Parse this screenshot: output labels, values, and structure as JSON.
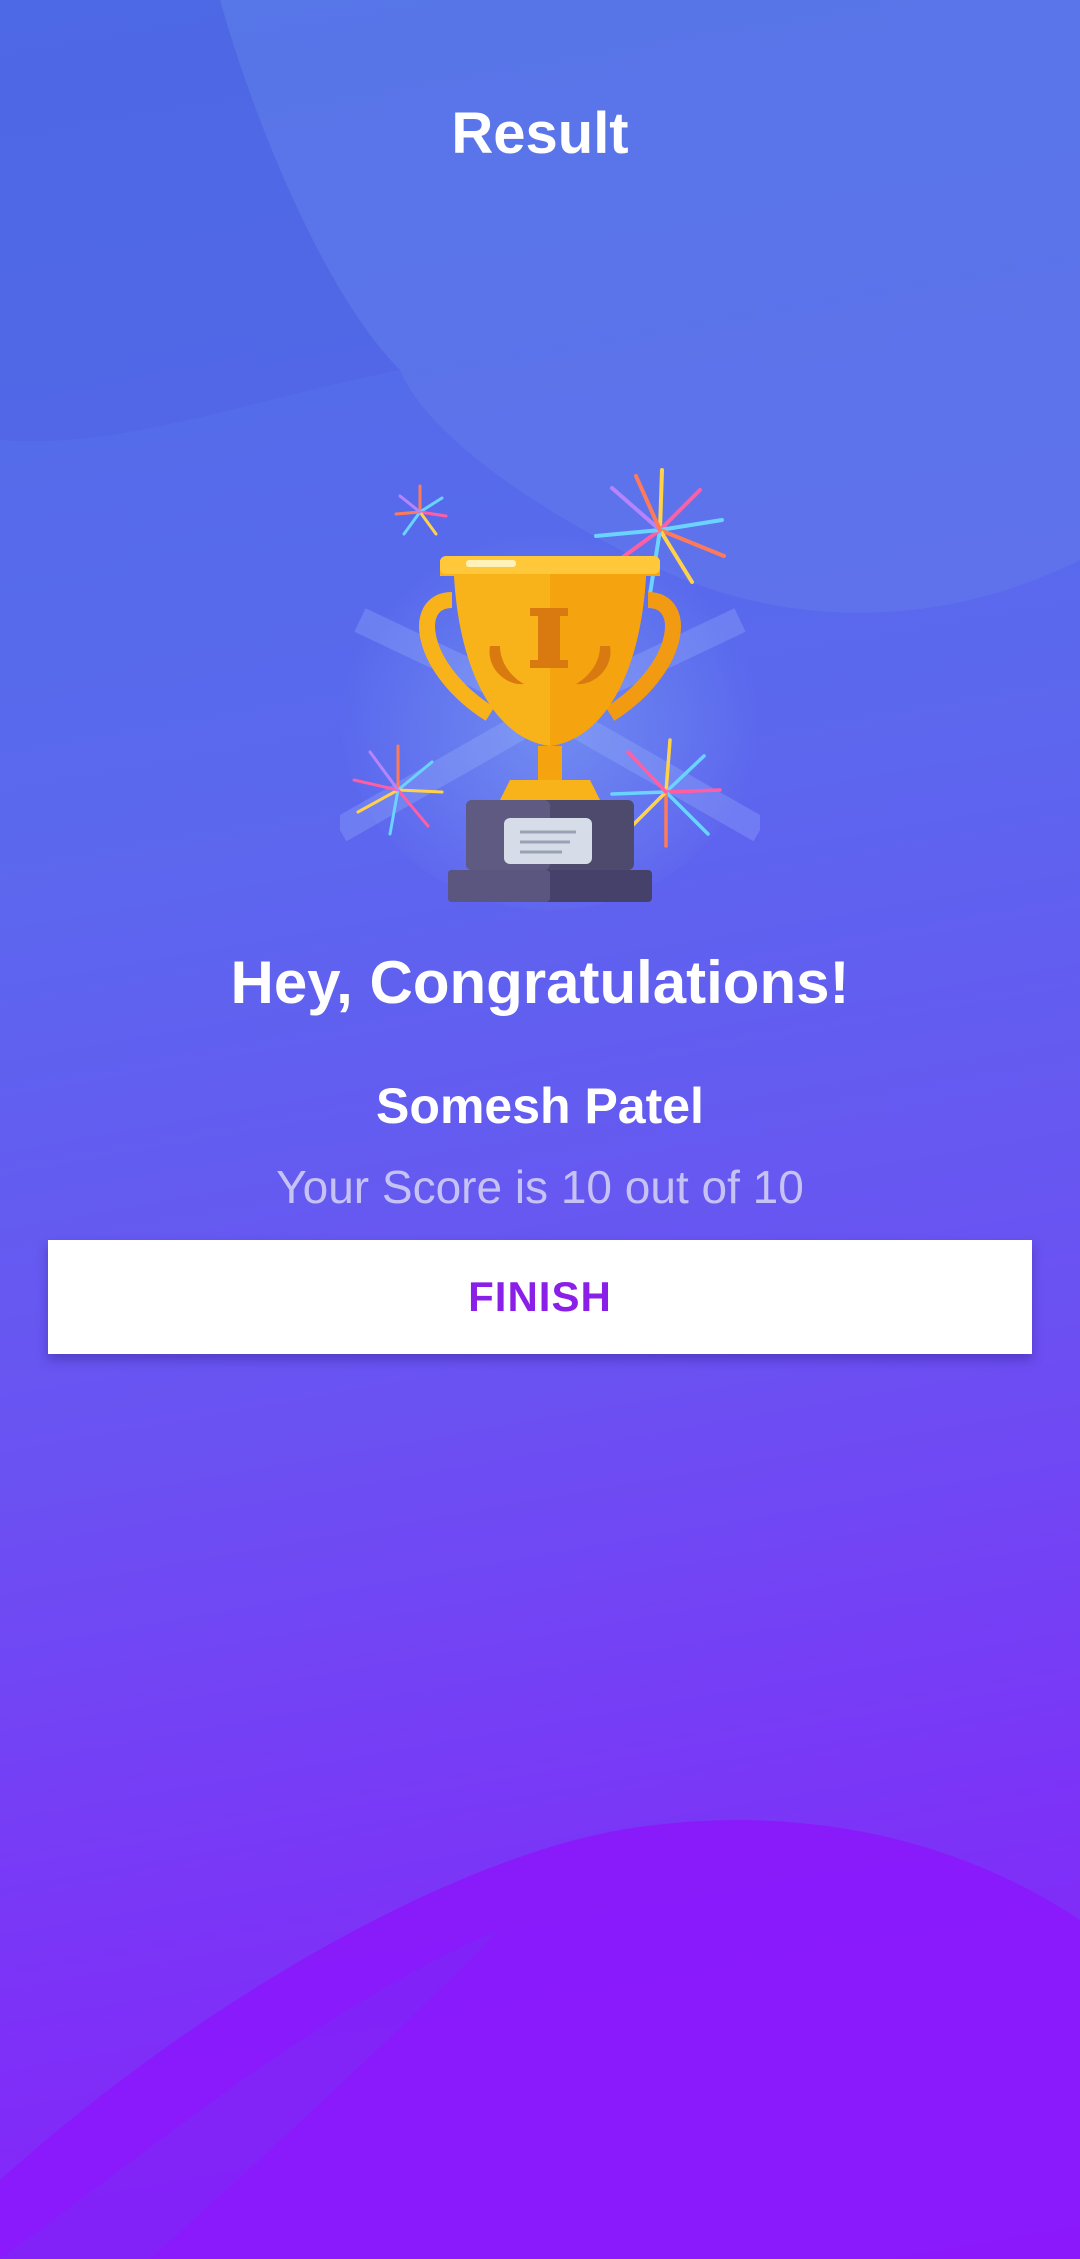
{
  "header": {
    "title": "Result"
  },
  "result": {
    "congrats": "Hey, Congratulations!",
    "name": "Somesh Patel",
    "score_text": "Your Score is 10 out of 10",
    "score": 10,
    "total": 10
  },
  "actions": {
    "finish_label": "FINISH"
  },
  "colors": {
    "background_top": "#4d6fe6",
    "background_bottom": "#8a1cfb",
    "button_text": "#8a20e8",
    "trophy_gold": "#f9b31a",
    "score_text": "#c6c2f4"
  }
}
